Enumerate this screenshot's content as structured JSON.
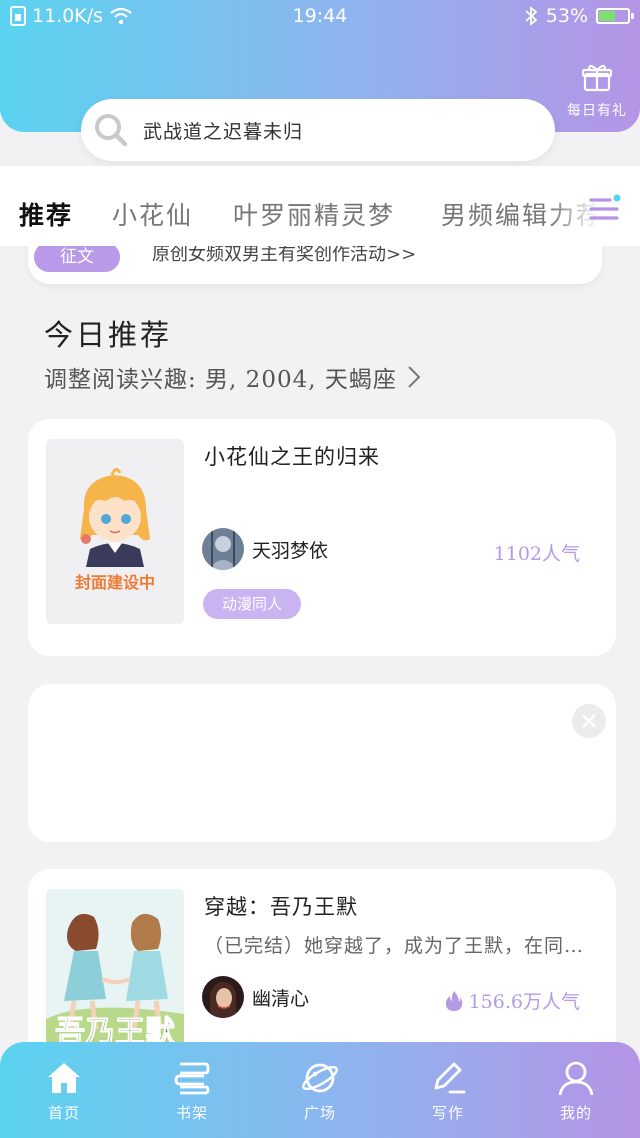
{
  "colors": {
    "accent": "#a98be6",
    "tag": "#c9b3f0",
    "popularity": "#b59be6",
    "gradient_start": "#5ad3f0",
    "gradient_end": "#b594e6"
  },
  "status_bar": {
    "network_speed": "11.0K/s",
    "time": "19:44",
    "battery": "53%"
  },
  "header": {
    "gift_label": "每日有礼",
    "search_query": "武战道之迟暮未归"
  },
  "tabs": [
    {
      "label": "推荐",
      "active": true
    },
    {
      "label": "小花仙",
      "active": false
    },
    {
      "label": "叶罗丽精灵梦",
      "active": false
    },
    {
      "label": "男频编辑力荐",
      "active": false
    }
  ],
  "banner": {
    "badge": "征文",
    "text": "原创女频双男主有奖创作活动>>"
  },
  "today": {
    "title": "今日推荐",
    "subtitle": "调整阅读兴趣: 男, 2004, 天蝎座"
  },
  "books": [
    {
      "title": "小花仙之王的归来",
      "cover_text": "封面建设中",
      "author": "天羽梦依",
      "popularity": "1102人气",
      "tag": "动漫同人"
    },
    {
      "title": "穿越：吾乃王默",
      "description": "（已完结）她穿越了，成为了王默，在同一天，她遇见了……",
      "author": "幽清心",
      "popularity": "156.6万人气",
      "cover_text": "吾乃王默"
    }
  ],
  "bottom_nav": [
    {
      "label": "首页",
      "icon": "home-icon"
    },
    {
      "label": "书架",
      "icon": "bookshelf-icon"
    },
    {
      "label": "广场",
      "icon": "planet-icon"
    },
    {
      "label": "写作",
      "icon": "pen-icon"
    },
    {
      "label": "我的",
      "icon": "user-icon"
    }
  ]
}
